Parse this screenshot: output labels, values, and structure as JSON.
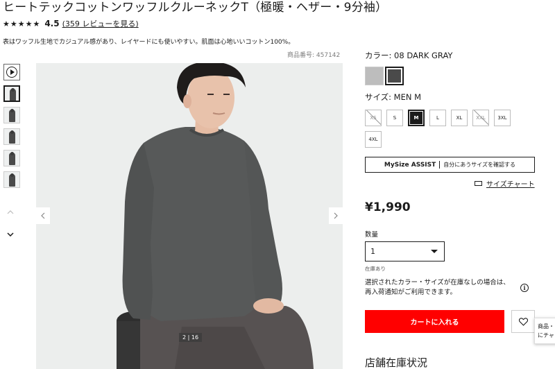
{
  "product": {
    "title": "ヒートテックコットンワッフルクルーネックT（極暖・ヘザー・9分袖）",
    "rating_stars": "★★★★★",
    "rating_value": "4.5",
    "review_link": "(359 レビューを見る)",
    "description": "表はワッフル生地でカジュアル感があり、レイヤードにも使いやすい。肌面は心地いいコットン100%。",
    "product_number": "商品番号: 457142"
  },
  "gallery": {
    "counter": "2 | 16",
    "thumbnails": [
      "video",
      "image",
      "image",
      "image",
      "image",
      "image"
    ],
    "prev_icon": "chevron-left-icon",
    "next_icon": "chevron-right-icon"
  },
  "color": {
    "label": "カラー:  08 DARK GRAY",
    "swatches": [
      {
        "name": "gray",
        "hex": "#bdbdbd",
        "selected": false
      },
      {
        "name": "dark-gray",
        "hex": "#4a4a4a",
        "selected": true
      }
    ]
  },
  "size": {
    "label": "サイズ:  MEN M",
    "options": [
      {
        "label": "XS",
        "state": "disabled"
      },
      {
        "label": "S",
        "state": "available"
      },
      {
        "label": "M",
        "state": "selected"
      },
      {
        "label": "L",
        "state": "available"
      },
      {
        "label": "XL",
        "state": "available"
      },
      {
        "label": "XXL",
        "state": "disabled"
      },
      {
        "label": "3XL",
        "state": "available"
      },
      {
        "label": "4XL",
        "state": "available"
      }
    ]
  },
  "mysize": {
    "brand": "MySize ASSIST",
    "text": "自分にあうサイズを確認する"
  },
  "size_chart": "サイズチャート",
  "price": "¥1,990",
  "quantity": {
    "label": "数量",
    "value": "1"
  },
  "stock_status": "在庫あり",
  "notice_line1": "選択されたカラー・サイズが在庫なしの場合は、",
  "notice_line2": "再入荷通知がご利用できます。",
  "cart_button": "カートに入れる",
  "popup": {
    "line1": "商品・",
    "line2": "にチャ"
  },
  "store_heading": "店舗在庫状況",
  "colors": {
    "accent_red": "#ff0000",
    "image_bg": "#eceeed"
  }
}
